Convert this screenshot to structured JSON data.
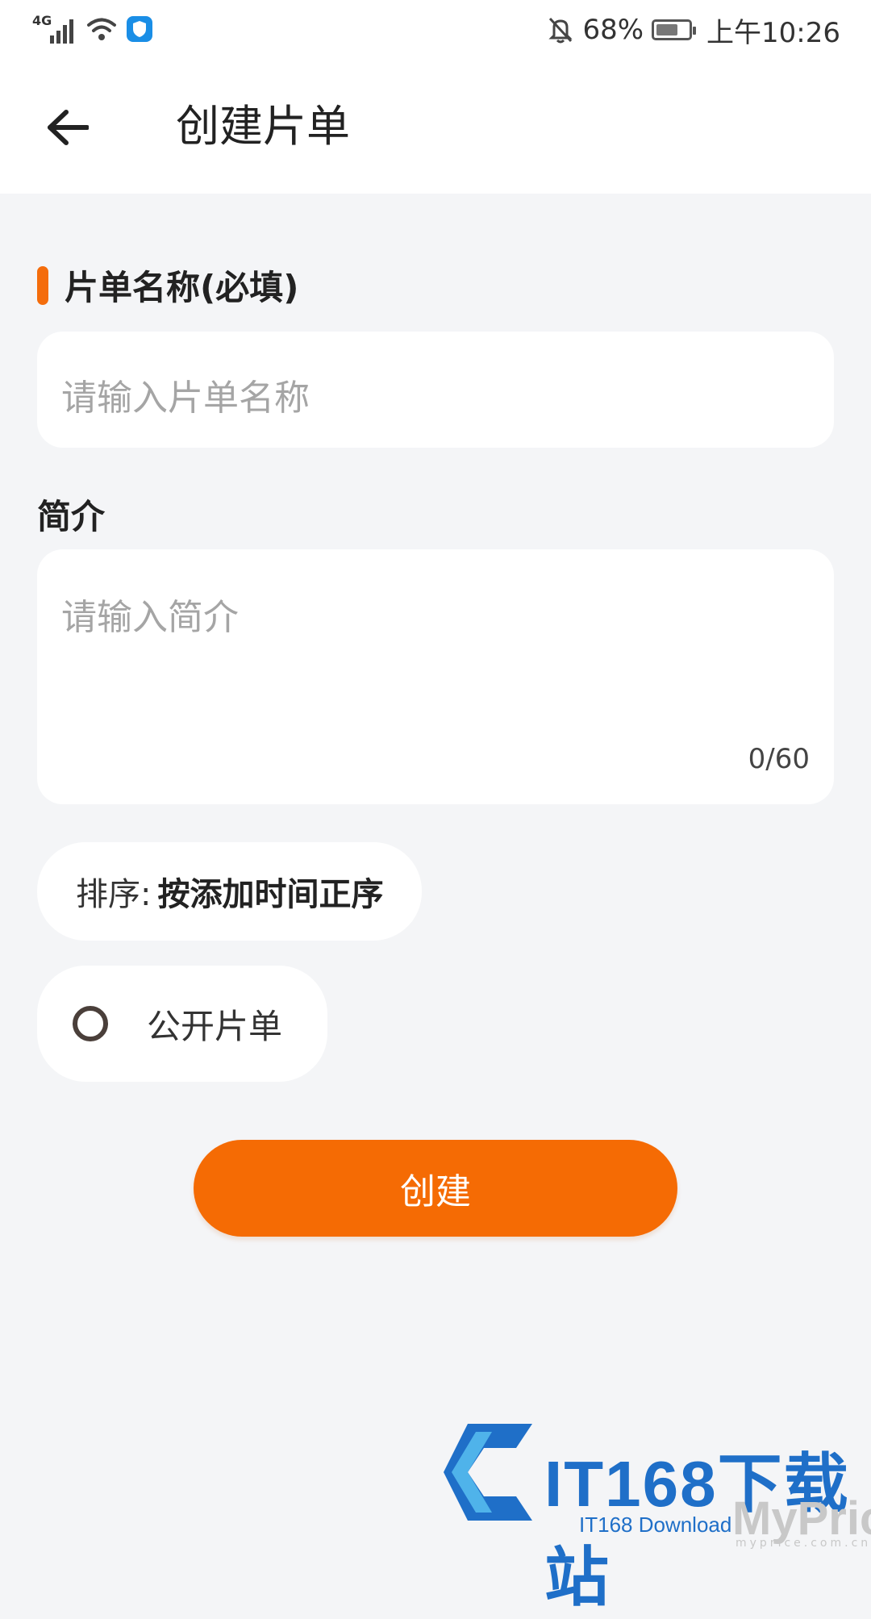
{
  "status_bar": {
    "network": "4G",
    "battery_percent": "68%",
    "time": "上午10:26",
    "battery_level": 0.68
  },
  "header": {
    "title": "创建片单"
  },
  "form": {
    "name_label": "片单名称(必填)",
    "name_placeholder": "请输入片单名称",
    "intro_label": "简介",
    "intro_placeholder": "请输入简介",
    "intro_counter": "0/60",
    "sort_prefix": "排序:",
    "sort_value": "按添加时间正序",
    "public_label": "公开片单",
    "public_checked": false,
    "submit_label": "创建"
  },
  "watermark": {
    "brand": "IT168下载站",
    "sub": "IT168 Download",
    "myprice": "MyPrice",
    "url": "myprice.com.cn"
  },
  "colors": {
    "accent": "#f46d0c",
    "background": "#f4f5f7",
    "card": "#ffffff",
    "placeholder": "#a5a5a5"
  }
}
